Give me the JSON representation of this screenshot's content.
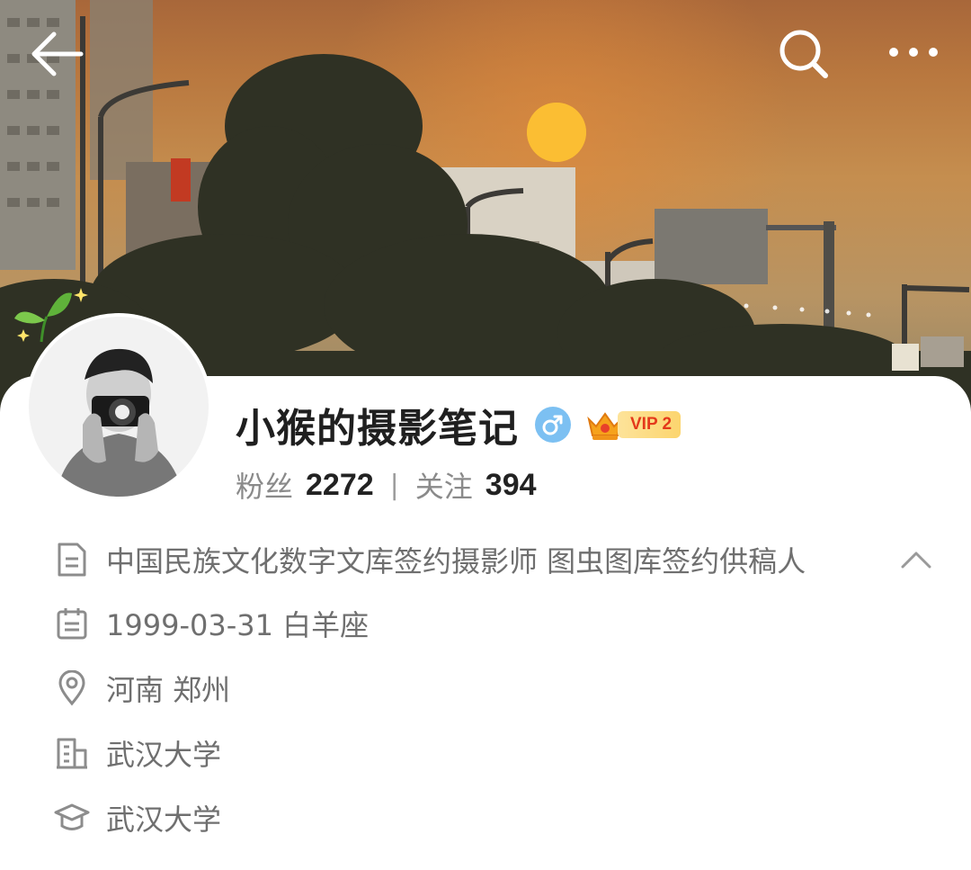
{
  "header": {
    "back_icon": "arrow-left-icon",
    "search_icon": "search-icon",
    "more_icon": "more-dots-icon"
  },
  "profile": {
    "name": "小猴的摄影笔记",
    "gender_icon": "male-icon",
    "vip_label": "VIP 2",
    "followers_label": "粉丝",
    "followers_count": "2272",
    "separator": "|",
    "following_label": "关注",
    "following_count": "394"
  },
  "info": {
    "bio": "中国民族文化数字文库签约摄影师 图虫图库签约供稿人",
    "birthday": "1999-03-31 白羊座",
    "location": "河南 郑州",
    "company": "武汉大学",
    "school": "武汉大学"
  },
  "colors": {
    "gender_badge": "#7cc0f2",
    "vip_text": "#e4391b",
    "vip_bg": "#fcd56e"
  }
}
